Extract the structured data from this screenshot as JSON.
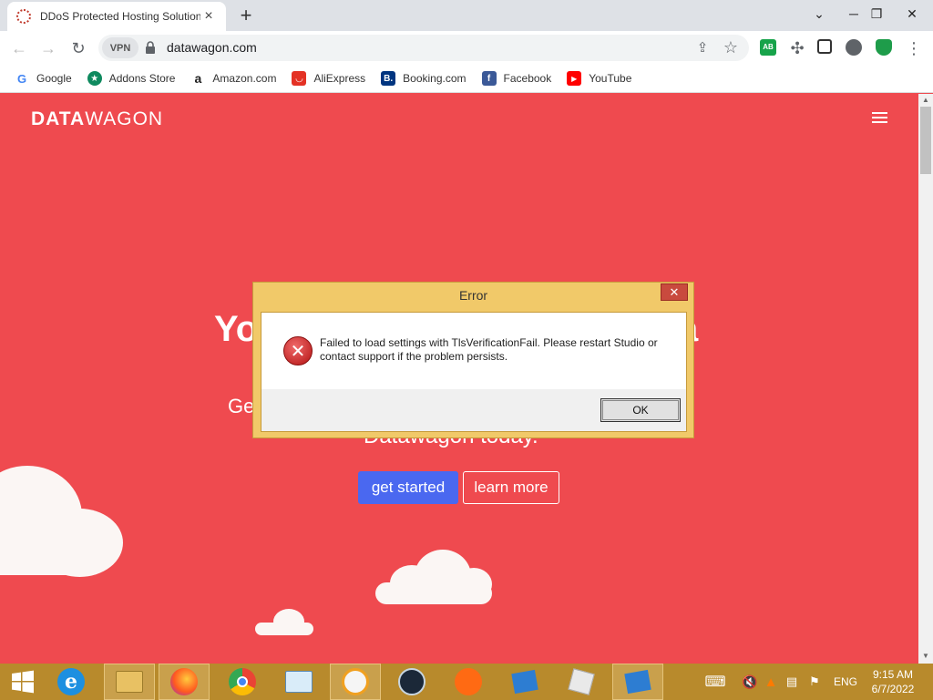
{
  "browser": {
    "tab_title": "DDoS Protected Hosting Solution",
    "tab_close": "×",
    "new_tab": "+",
    "url": "datawagon.com",
    "vpn_label": "VPN",
    "win_minimize": "─",
    "win_restore": "❐",
    "win_close": "✕"
  },
  "bookmarks": [
    {
      "label": "Google",
      "icon": "google-icon",
      "color": "#4285f4",
      "glyph": "G"
    },
    {
      "label": "Addons Store",
      "icon": "addons-icon",
      "color": "#0f8a5f",
      "glyph": "★"
    },
    {
      "label": "Amazon.com",
      "icon": "amazon-icon",
      "color": "#222222",
      "glyph": "a"
    },
    {
      "label": "AliExpress",
      "icon": "aliexpress-icon",
      "color": "#e43225",
      "glyph": "◡"
    },
    {
      "label": "Booking.com",
      "icon": "booking-icon",
      "color": "#003580",
      "glyph": "B."
    },
    {
      "label": "Facebook",
      "icon": "facebook-icon",
      "color": "#3b5998",
      "glyph": "f"
    },
    {
      "label": "YouTube",
      "icon": "youtube-icon",
      "color": "#ff0000",
      "glyph": "▶"
    }
  ],
  "site": {
    "brand_bold": "DATA",
    "brand_light": "WAGON",
    "hero_left": "Yo",
    "hero_right": "a",
    "sub_left": "Ge",
    "sub_center": "Datawagon today.",
    "btn_start": "get started",
    "btn_more": "learn more",
    "accent": "#ef4a4f"
  },
  "dialog": {
    "title": "Error",
    "close": "✕",
    "message": "Failed to load settings with TlsVerificationFail. Please restart Studio or contact support if the problem persists.",
    "ok_label": "OK",
    "icon": "error-icon"
  },
  "taskbar": {
    "lang": "ENG",
    "time": "9:15 AM",
    "date": "6/7/2022"
  }
}
